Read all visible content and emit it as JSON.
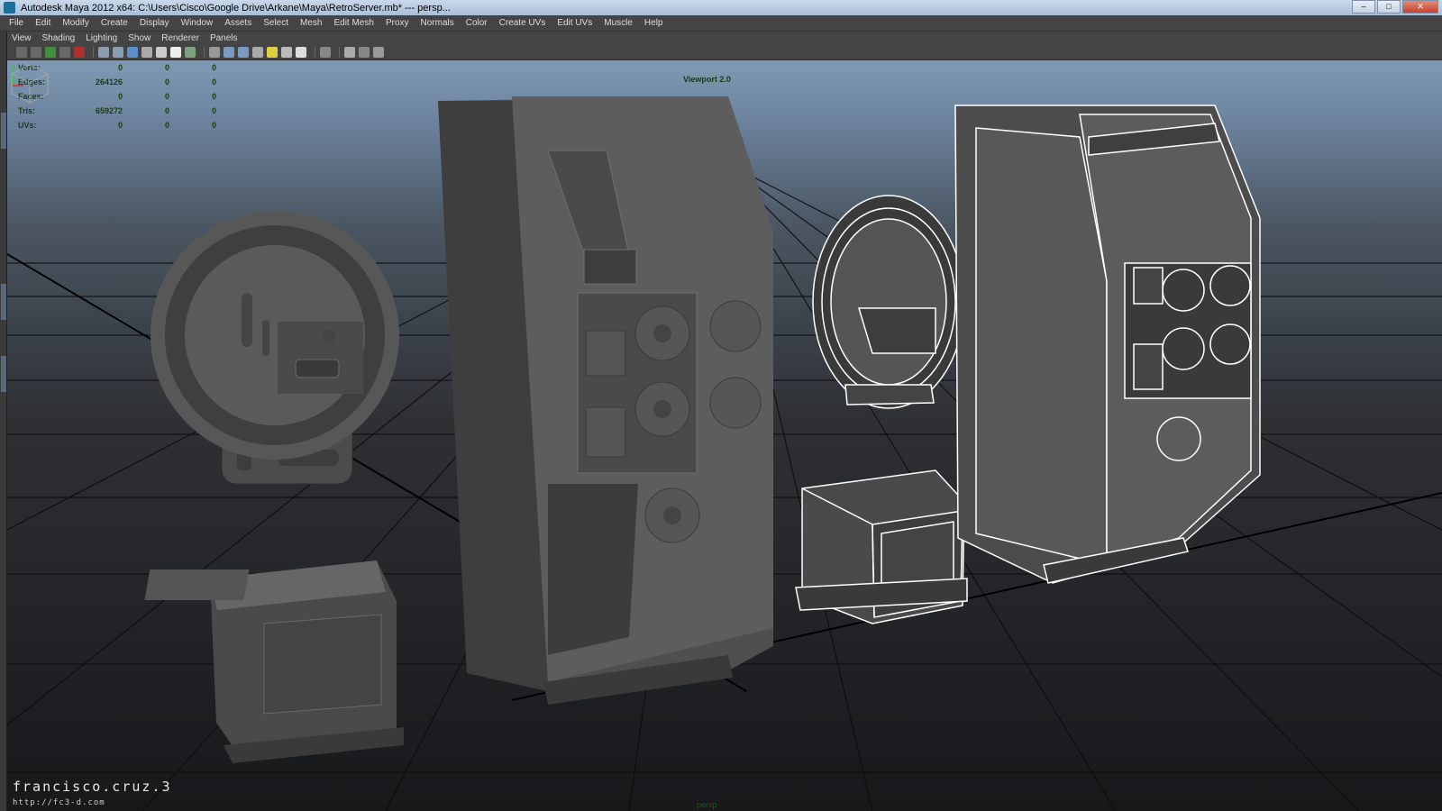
{
  "window": {
    "title": "Autodesk Maya 2012 x64: C:\\Users\\Cisco\\Google Drive\\Arkane\\Maya\\RetroServer.mb*   ---   persp..."
  },
  "main_menu": [
    "File",
    "Edit",
    "Modify",
    "Create",
    "Display",
    "Window",
    "Assets",
    "Select",
    "Mesh",
    "Edit Mesh",
    "Proxy",
    "Normals",
    "Color",
    "Create UVs",
    "Edit UVs",
    "Muscle",
    "Help"
  ],
  "panel_menu": [
    "View",
    "Shading",
    "Lighting",
    "Show",
    "Renderer",
    "Panels"
  ],
  "hud": {
    "rows": [
      {
        "label": "Verts:",
        "values": [
          "0",
          "0",
          "0"
        ]
      },
      {
        "label": "Edges:",
        "values": [
          "264126",
          "0",
          "0"
        ]
      },
      {
        "label": "Faces:",
        "values": [
          "0",
          "0",
          "0"
        ]
      },
      {
        "label": "Tris:",
        "values": [
          "659272",
          "0",
          "0"
        ]
      },
      {
        "label": "UVs:",
        "values": [
          "0",
          "0",
          "0"
        ]
      }
    ]
  },
  "viewport": {
    "renderer_label": "Viewport 2.0",
    "camera_name": "persp"
  },
  "watermark": {
    "name": "francisco.cruz.3",
    "url": "http://fc3-d.com"
  },
  "colors": {
    "hud_text": "#1b3a1b",
    "menu_bg": "#444444",
    "viewport_top": "#7f9ab4",
    "viewport_bottom": "#17181a",
    "grid": "#0d0d0d",
    "mesh_gray": "#5f5f5f",
    "wire": "#ffffff"
  }
}
